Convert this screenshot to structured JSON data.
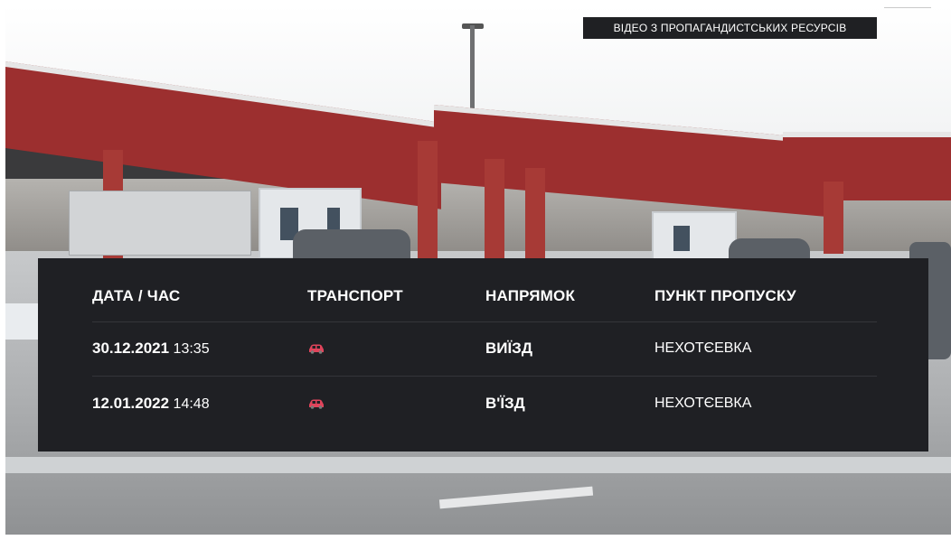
{
  "overlay_badge": "ВІДЕО З ПРОПАГАНДИСТСЬКИХ РЕСУРСІВ",
  "table": {
    "headers": [
      "ДАТА / ЧАС",
      "ТРАНСПОРТ",
      "НАПРЯМОК",
      "ПУНКТ ПРОПУСКУ"
    ],
    "rows": [
      {
        "date": "30.12.2021",
        "time": "13:35",
        "transport_icon": "car-icon",
        "direction": "ВИЇЗД",
        "checkpoint": "НЕХОТЄЕВКА"
      },
      {
        "date": "12.01.2022",
        "time": "14:48",
        "transport_icon": "car-icon",
        "direction": "В'ЇЗД",
        "checkpoint": "НЕХОТЄЕВКА"
      }
    ]
  },
  "colors": {
    "panel_bg": "#1f2024",
    "badge_bg": "#1f2023",
    "car_icon": "#e0445b",
    "roof": "#9c2f2f"
  }
}
